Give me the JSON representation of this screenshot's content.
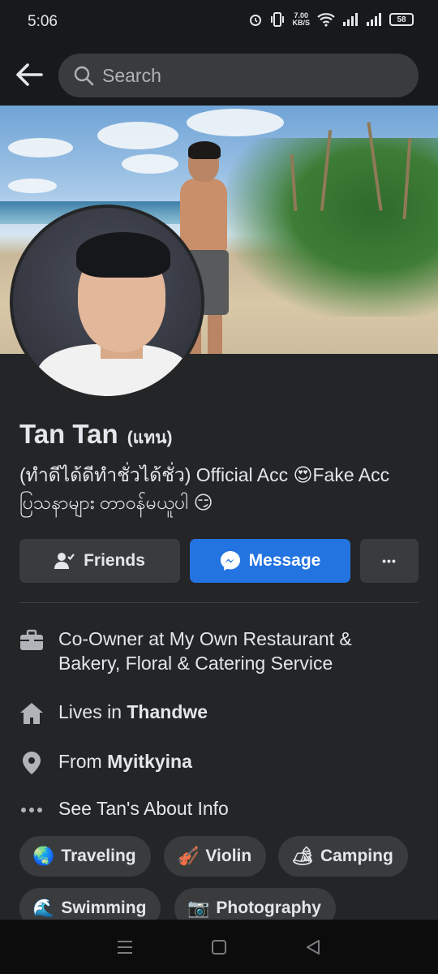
{
  "status_bar": {
    "time": "5:06",
    "net_speed_value": "7.00",
    "net_speed_unit": "KB/S",
    "battery": "58"
  },
  "search": {
    "placeholder": "Search"
  },
  "profile": {
    "name": "Tan Tan",
    "alternate_name": "(แทน)",
    "bio": "(ทำดีได้ดีทำชั่วได้ชั่ว) Official Acc 😍Fake Acc ပြသနာများ တာဝန်မယူပါ 😏"
  },
  "actions": {
    "friends_label": "Friends",
    "message_label": "Message",
    "more_label": "•••"
  },
  "intro": {
    "work": "Co-Owner at My Own Restaurant & Bakery, Floral & Catering Service",
    "lives_prefix": "Lives in ",
    "lives_city": "Thandwe",
    "from_prefix": "From ",
    "from_city": "Myitkyina",
    "about_link": "See Tan's About Info"
  },
  "hobbies": [
    {
      "emoji": "🌏",
      "label": "Traveling"
    },
    {
      "emoji": "🎻",
      "label": "Violin"
    },
    {
      "emoji": "🏕",
      "label": "Camping"
    },
    {
      "emoji": "🌊",
      "label": "Swimming"
    },
    {
      "emoji": "📷",
      "label": "Photography"
    }
  ],
  "colors": {
    "background": "#242526",
    "header": "#18191a",
    "button": "#3a3b3c",
    "primary": "#2374e1",
    "text": "#e4e6eb"
  },
  "icons": {
    "back": "arrow-left-icon",
    "search": "magnifier-icon",
    "friends": "person-check-icon",
    "message": "messenger-icon",
    "work": "briefcase-icon",
    "home": "house-icon",
    "location": "map-pin-icon",
    "more": "dots-icon"
  }
}
